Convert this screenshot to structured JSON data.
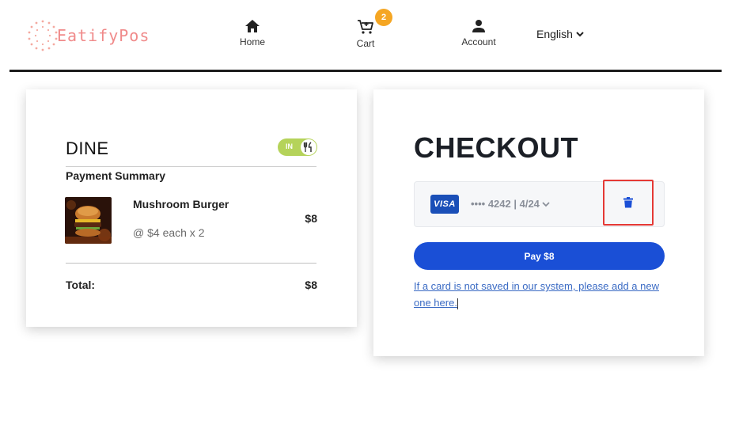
{
  "header": {
    "logo_text": "EatifyPos",
    "nav": {
      "home_label": "Home",
      "cart_label": "Cart",
      "cart_count": "2",
      "account_label": "Account"
    },
    "language": "English"
  },
  "order": {
    "dine_label": "DINE",
    "dine_toggle_text": "IN",
    "summary_heading": "Payment Summary",
    "items": [
      {
        "name": "Mushroom Burger",
        "qty_text": "@ $4 each x 2",
        "price": "$8"
      }
    ],
    "total_label": "Total:",
    "total_value": "$8"
  },
  "checkout": {
    "title": "CHECKOUT",
    "card_brand": "VISA",
    "card_text": "•••• 4242 | 4/24",
    "pay_label": "Pay $8",
    "add_card_text": "If a card is not saved in our system, please add a new one here."
  },
  "colors": {
    "brand_logo": "#f08a8a",
    "badge": "#f5a623",
    "toggle": "#b5d35a",
    "primary_button": "#1a4fd6",
    "highlight_border": "#e53935"
  },
  "icons": [
    "logo-dots-icon",
    "home-icon",
    "cart-icon",
    "person-icon",
    "chevron-down-icon",
    "utensils-icon",
    "trash-icon"
  ]
}
